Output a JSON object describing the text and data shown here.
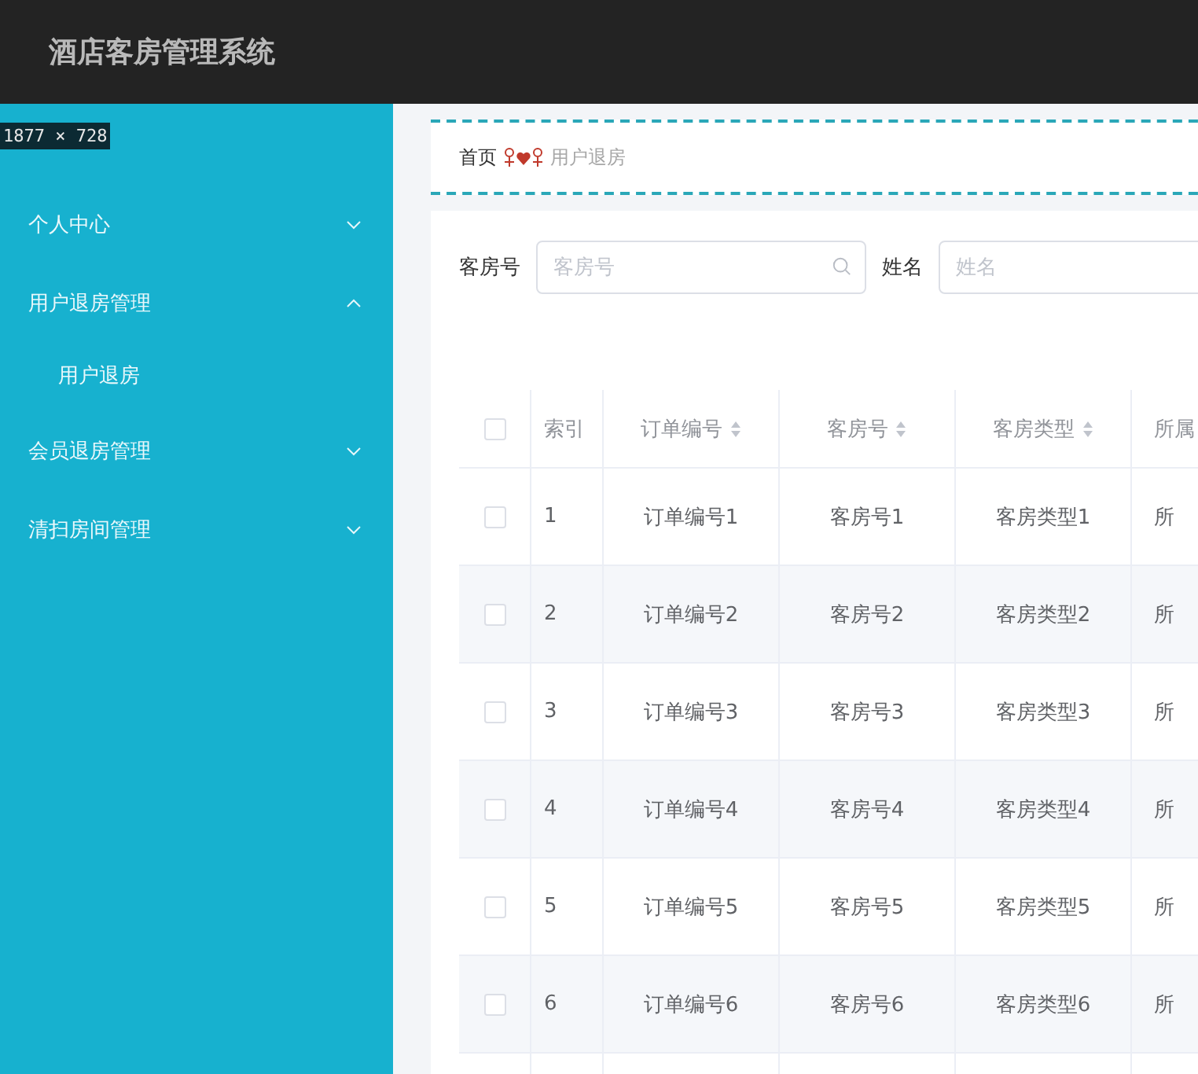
{
  "header": {
    "title": "酒店客房管理系统"
  },
  "size_badge": {
    "text": "1877 × 728"
  },
  "sidebar": {
    "items": [
      {
        "label": "个人中心",
        "expanded": false
      },
      {
        "label": "用户退房管理",
        "expanded": true,
        "children": [
          {
            "label": "用户退房"
          }
        ]
      },
      {
        "label": "会员退房管理",
        "expanded": false
      },
      {
        "label": "清扫房间管理",
        "expanded": false
      }
    ]
  },
  "breadcrumb": {
    "items": [
      "首页",
      "用户退房"
    ]
  },
  "search": {
    "fields": [
      {
        "label": "客房号",
        "placeholder": "客房号",
        "kind": "search"
      },
      {
        "label": "姓名",
        "placeholder": "姓名",
        "kind": "plain"
      }
    ]
  },
  "table": {
    "all_checked": false,
    "columns": [
      {
        "label": "索引",
        "sortable": false
      },
      {
        "label": "订单编号",
        "sortable": true
      },
      {
        "label": "客房号",
        "sortable": true
      },
      {
        "label": "客房类型",
        "sortable": true
      },
      {
        "label": "所属"
      }
    ],
    "rows": [
      {
        "checked": false,
        "cells": [
          "1",
          "订单编号1",
          "客房号1",
          "客房类型1",
          "所"
        ]
      },
      {
        "checked": false,
        "cells": [
          "2",
          "订单编号2",
          "客房号2",
          "客房类型2",
          "所"
        ]
      },
      {
        "checked": false,
        "cells": [
          "3",
          "订单编号3",
          "客房号3",
          "客房类型3",
          "所"
        ]
      },
      {
        "checked": false,
        "cells": [
          "4",
          "订单编号4",
          "客房号4",
          "客房类型4",
          "所"
        ]
      },
      {
        "checked": false,
        "cells": [
          "5",
          "订单编号5",
          "客房号5",
          "客房类型5",
          "所"
        ]
      },
      {
        "checked": false,
        "cells": [
          "6",
          "订单编号6",
          "客房号6",
          "客房类型6",
          "所"
        ]
      }
    ]
  }
}
